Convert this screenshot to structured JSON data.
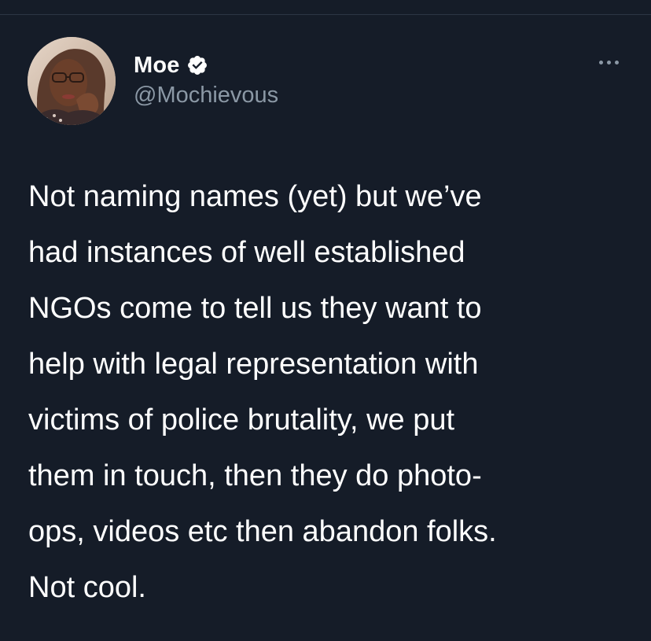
{
  "tweet": {
    "author": {
      "display_name": "Moe",
      "handle": "@Mochievous",
      "verified": true
    },
    "text_lines": [
      "Not naming names (yet) but we’ve",
      "had instances of well established",
      "NGOs come to tell us they want to",
      "help with legal representation with",
      "victims of police brutality, we put",
      "them in touch, then they do photo-",
      "ops, videos etc then abandon folks.",
      "Not cool."
    ]
  },
  "icons": {
    "verified": "verified-badge-icon",
    "more": "more-options-icon"
  },
  "colors": {
    "background": "#151c28",
    "text": "#ffffff",
    "secondary_text": "#8b98a5"
  }
}
